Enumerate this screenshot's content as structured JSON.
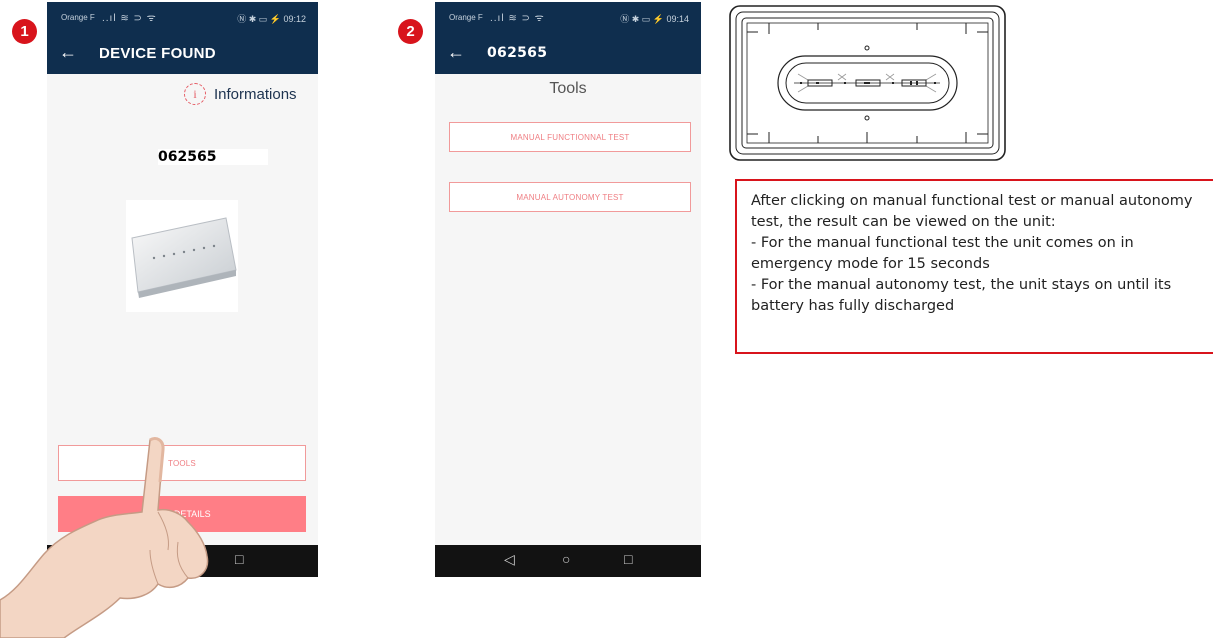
{
  "steps": [
    "1",
    "2"
  ],
  "screen1": {
    "status": {
      "carrier": "Orange F",
      "signal": "..ıl ≋ ⊃ ᯤ",
      "right_info": "Ⓝ ✱ ▭ ⚡ 09:12"
    },
    "appbar_title": "DEVICE FOUND",
    "back_glyph": "←",
    "info_label": "Informations",
    "info_glyph": "i",
    "device_id": "062565",
    "tools_button": "TOOLS",
    "details_button": "SEE DETAILS",
    "nav": {
      "home": "○",
      "recent": "□"
    }
  },
  "screen2": {
    "status": {
      "carrier": "Orange F",
      "signal": "..ıl ≋ ⊃ ᯤ",
      "right_info": "Ⓝ ✱ ▭ ⚡ 09:14"
    },
    "appbar_title": "062565",
    "back_glyph": "←",
    "page_title": "Tools",
    "functional_test_button": "MANUAL FUNCTIONNAL TEST",
    "autonomy_test_button": "MANUAL AUTONOMY TEST",
    "nav": {
      "back": "◁",
      "home": "○",
      "recent": "□"
    }
  },
  "note": {
    "intro": "After clicking on manual functional test or manual autonomy test, the result can be viewed on the unit:",
    "bullets": [
      "- For the manual functional test the unit comes on in emergency mode for 15 seconds",
      "- For the manual autonomy test, the unit stays on until its battery has fully discharged"
    ]
  },
  "colors": {
    "appbar": "#0f2e4e",
    "accent": "#d8141c",
    "button_pink": "#ff7e86"
  }
}
